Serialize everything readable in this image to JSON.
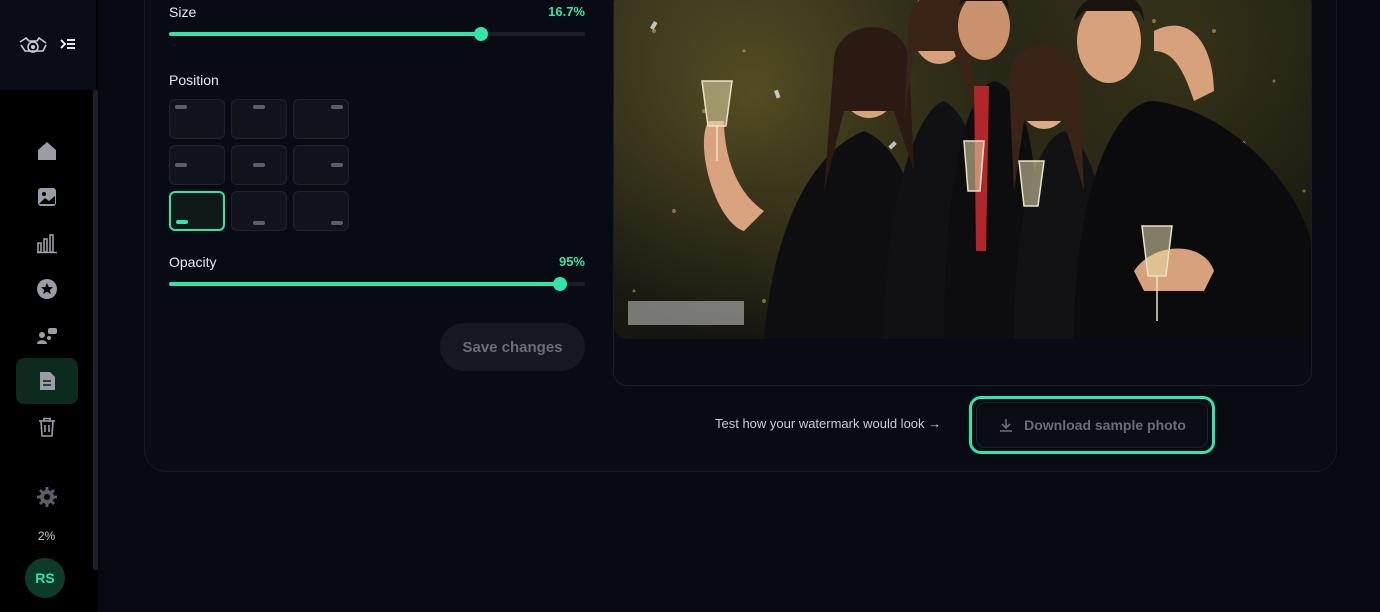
{
  "sidebar": {
    "logo": "watermark-camera-logo",
    "nav": [
      {
        "name": "home",
        "icon": "home-icon"
      },
      {
        "name": "images",
        "icon": "image-icon"
      },
      {
        "name": "analytics",
        "icon": "bar-chart-icon"
      },
      {
        "name": "favorites",
        "icon": "star-icon"
      },
      {
        "name": "team",
        "icon": "users-icon"
      },
      {
        "name": "watermark",
        "icon": "document-icon",
        "active": true
      },
      {
        "name": "trash",
        "icon": "trash-icon"
      },
      {
        "name": "settings",
        "icon": "gear-icon"
      }
    ],
    "usage": "2%",
    "avatar_initials": "RS"
  },
  "settings": {
    "size": {
      "label": "Size",
      "value_text": "16.7%",
      "value": 0.75
    },
    "position": {
      "label": "Position",
      "selected": "bottom-left"
    },
    "opacity": {
      "label": "Opacity",
      "value_text": "95%",
      "value": 0.94
    },
    "save_label": "Save changes"
  },
  "preview": {
    "hint": "Test how your watermark would look →",
    "download_label": "Download sample photo"
  },
  "colors": {
    "accent": "#2ee6a8",
    "background": "#070911",
    "card": "#090b14"
  }
}
